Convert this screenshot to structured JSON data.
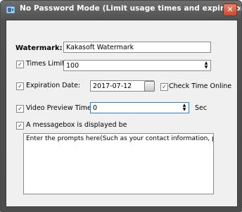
{
  "window": {
    "title": "No Password Mode (Limit usage times and expiration date)",
    "close_glyph": "✕"
  },
  "form": {
    "watermark": {
      "label": "Watermark:",
      "value": "Kakasoft Watermark"
    },
    "times_limit": {
      "label": "Times Limit:",
      "checked": true,
      "value": "100"
    },
    "expiration_date": {
      "label": "Expiration Date:",
      "checked": true,
      "value": "2017-07-12"
    },
    "check_time_online": {
      "label": "Check Time Online",
      "checked": true
    },
    "video_preview_time": {
      "label": "Video Preview Time:",
      "checked": true,
      "value": "0",
      "unit": "Sec"
    },
    "messagebox": {
      "label": "A messagebox is displayed be",
      "checked": true,
      "text": "Enter the prompts here(Such as your contact information, purchase"
    }
  },
  "icons": {
    "app": "app-icon",
    "close": "close-icon",
    "calendar": "calendar-icon",
    "spin": "spin-arrows-icon"
  }
}
